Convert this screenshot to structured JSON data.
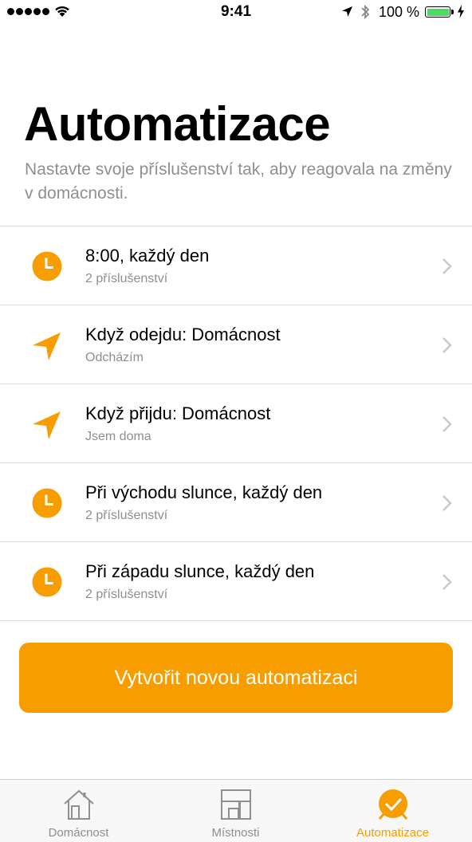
{
  "status_bar": {
    "time": "9:41",
    "battery_percent": "100 %",
    "battery_level": 1.0,
    "icons": [
      "signal-dots-icon",
      "wifi-icon",
      "location-arrow-icon",
      "bluetooth-icon",
      "battery-icon",
      "charging-bolt-icon"
    ]
  },
  "header": {
    "title": "Automatizace",
    "subtitle": "Nastavte svoje příslušenství tak, aby reagovala na změny v domácnosti."
  },
  "automations": [
    {
      "icon": "clock-icon",
      "title": "8:00, každý den",
      "subtitle": "2 příslušenství"
    },
    {
      "icon": "location-arrow-icon",
      "title": "Když odejdu: Domácnost",
      "subtitle": "Odcházím"
    },
    {
      "icon": "location-arrow-icon",
      "title": "Když přijdu: Domácnost",
      "subtitle": "Jsem doma"
    },
    {
      "icon": "clock-icon",
      "title": "Při východu slunce, každý den",
      "subtitle": "2 příslušenství"
    },
    {
      "icon": "clock-icon",
      "title": "Při západu slunce, každý den",
      "subtitle": "2 příslušenství"
    }
  ],
  "create_button": {
    "label": "Vytvořit novou automatizaci"
  },
  "tab_bar": {
    "tabs": [
      {
        "icon": "house-icon",
        "label": "Domácnost",
        "active": false
      },
      {
        "icon": "rooms-icon",
        "label": "Místnosti",
        "active": false
      },
      {
        "icon": "automation-check-icon",
        "label": "Automatizace",
        "active": true
      }
    ]
  },
  "colors": {
    "accent": "#f79d00",
    "secondary_text": "#8e8e93",
    "battery_green": "#4cd964",
    "separator": "#d8d8d8"
  }
}
